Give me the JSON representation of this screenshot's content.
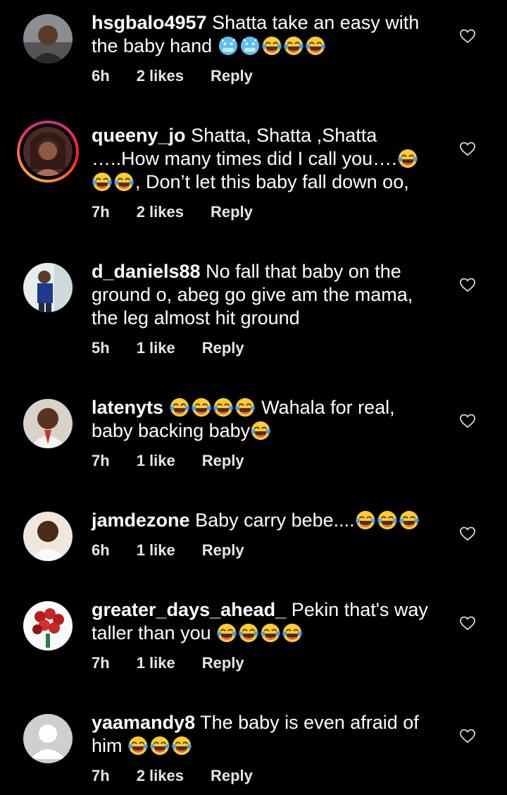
{
  "comments": [
    {
      "username": "hsgbalo4957",
      "text": "Shatta take an easy with the baby hand",
      "emojis": "🥶🥶😂😂😂",
      "time": "6h",
      "likes": "2 likes",
      "reply": "Reply"
    },
    {
      "username": "queeny_jo",
      "text": "Shatta, Shatta ,Shatta …..How many times did I call you….",
      "text2": ", Don’t let this baby fall down oo,",
      "time": "7h",
      "likes": "2 likes",
      "reply": "Reply"
    },
    {
      "username": "d_daniels88",
      "text": "No fall that baby on the ground o, abeg go give am the mama, the leg almost hit ground",
      "time": "5h",
      "likes": "1 like",
      "reply": "Reply"
    },
    {
      "username": "latenyts",
      "text": "Wahala for real, baby backing baby",
      "time": "7h",
      "likes": "1 like",
      "reply": "Reply"
    },
    {
      "username": "jamdezone",
      "text": "Baby carry bebe....",
      "time": "6h",
      "likes": "1 like",
      "reply": "Reply"
    },
    {
      "username": "greater_days_ahead_",
      "text": "Pekin that's way taller than you",
      "time": "7h",
      "likes": "1 like",
      "reply": "Reply"
    },
    {
      "username": "yaamandy8",
      "text": "The baby is even afraid of him",
      "time": "7h",
      "likes": "2 likes",
      "reply": "Reply"
    }
  ],
  "icons": {
    "like": "heart-outline-icon",
    "laugh": "tears-of-joy-emoji",
    "cold": "cold-face-emoji"
  }
}
